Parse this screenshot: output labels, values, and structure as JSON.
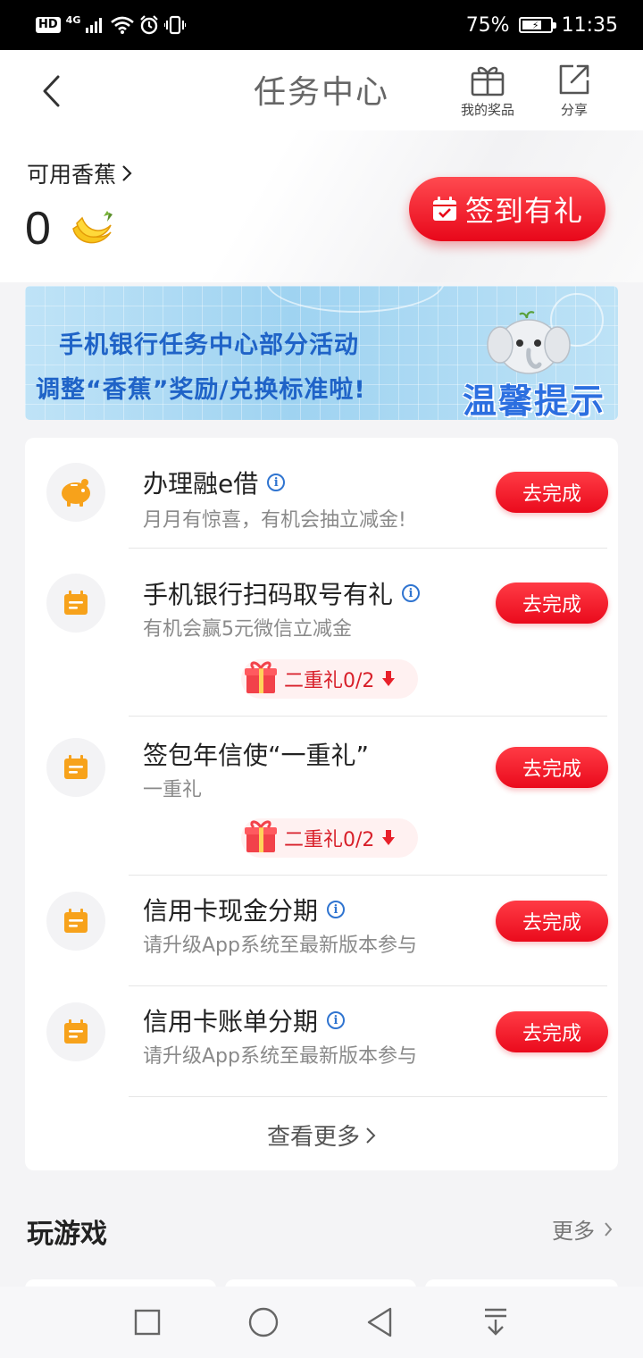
{
  "status_bar": {
    "hd": "HD",
    "net": "4G",
    "battery": "75%",
    "battery_level": 0.75,
    "time": "11:35"
  },
  "header": {
    "title": "任务中心",
    "my_prizes": "我的奖品",
    "share": "分享"
  },
  "balance": {
    "label": "可用香蕉",
    "value": "0"
  },
  "signin_button": "签到有礼",
  "banner": {
    "line1": "手机银行任务中心部分活动",
    "line2": "调整“香蕉”奖励/兑换标准啦!",
    "tip": "温馨提示"
  },
  "tasks": [
    {
      "title": "办理融e借",
      "desc": "月月有惊喜，有机会抽立减金!",
      "button": "去完成",
      "icon": "piggy-bank-icon"
    },
    {
      "title": "手机银行扫码取号有礼",
      "desc": "有机会赢5元微信立减金",
      "button": "去完成",
      "icon": "calendar-icon",
      "reward": "二重礼0/2"
    },
    {
      "title": "签包年信使“一重礼”",
      "desc": "一重礼",
      "button": "去完成",
      "icon": "calendar-icon",
      "reward": "二重礼0/2"
    },
    {
      "title": "信用卡现金分期",
      "desc": "请升级App系统至最新版本参与",
      "button": "去完成",
      "icon": "calendar-icon"
    },
    {
      "title": "信用卡账单分期",
      "desc": "请升级App系统至最新版本参与",
      "button": "去完成",
      "icon": "calendar-icon"
    }
  ],
  "see_more": "查看更多",
  "games": {
    "title": "玩游戏",
    "more": "更多"
  },
  "colors": {
    "accent_red": "#ea0a1c",
    "info_blue": "#2f74d0",
    "icon_orange": "#f7a21b",
    "banner_text_blue": "#1f63c7"
  }
}
